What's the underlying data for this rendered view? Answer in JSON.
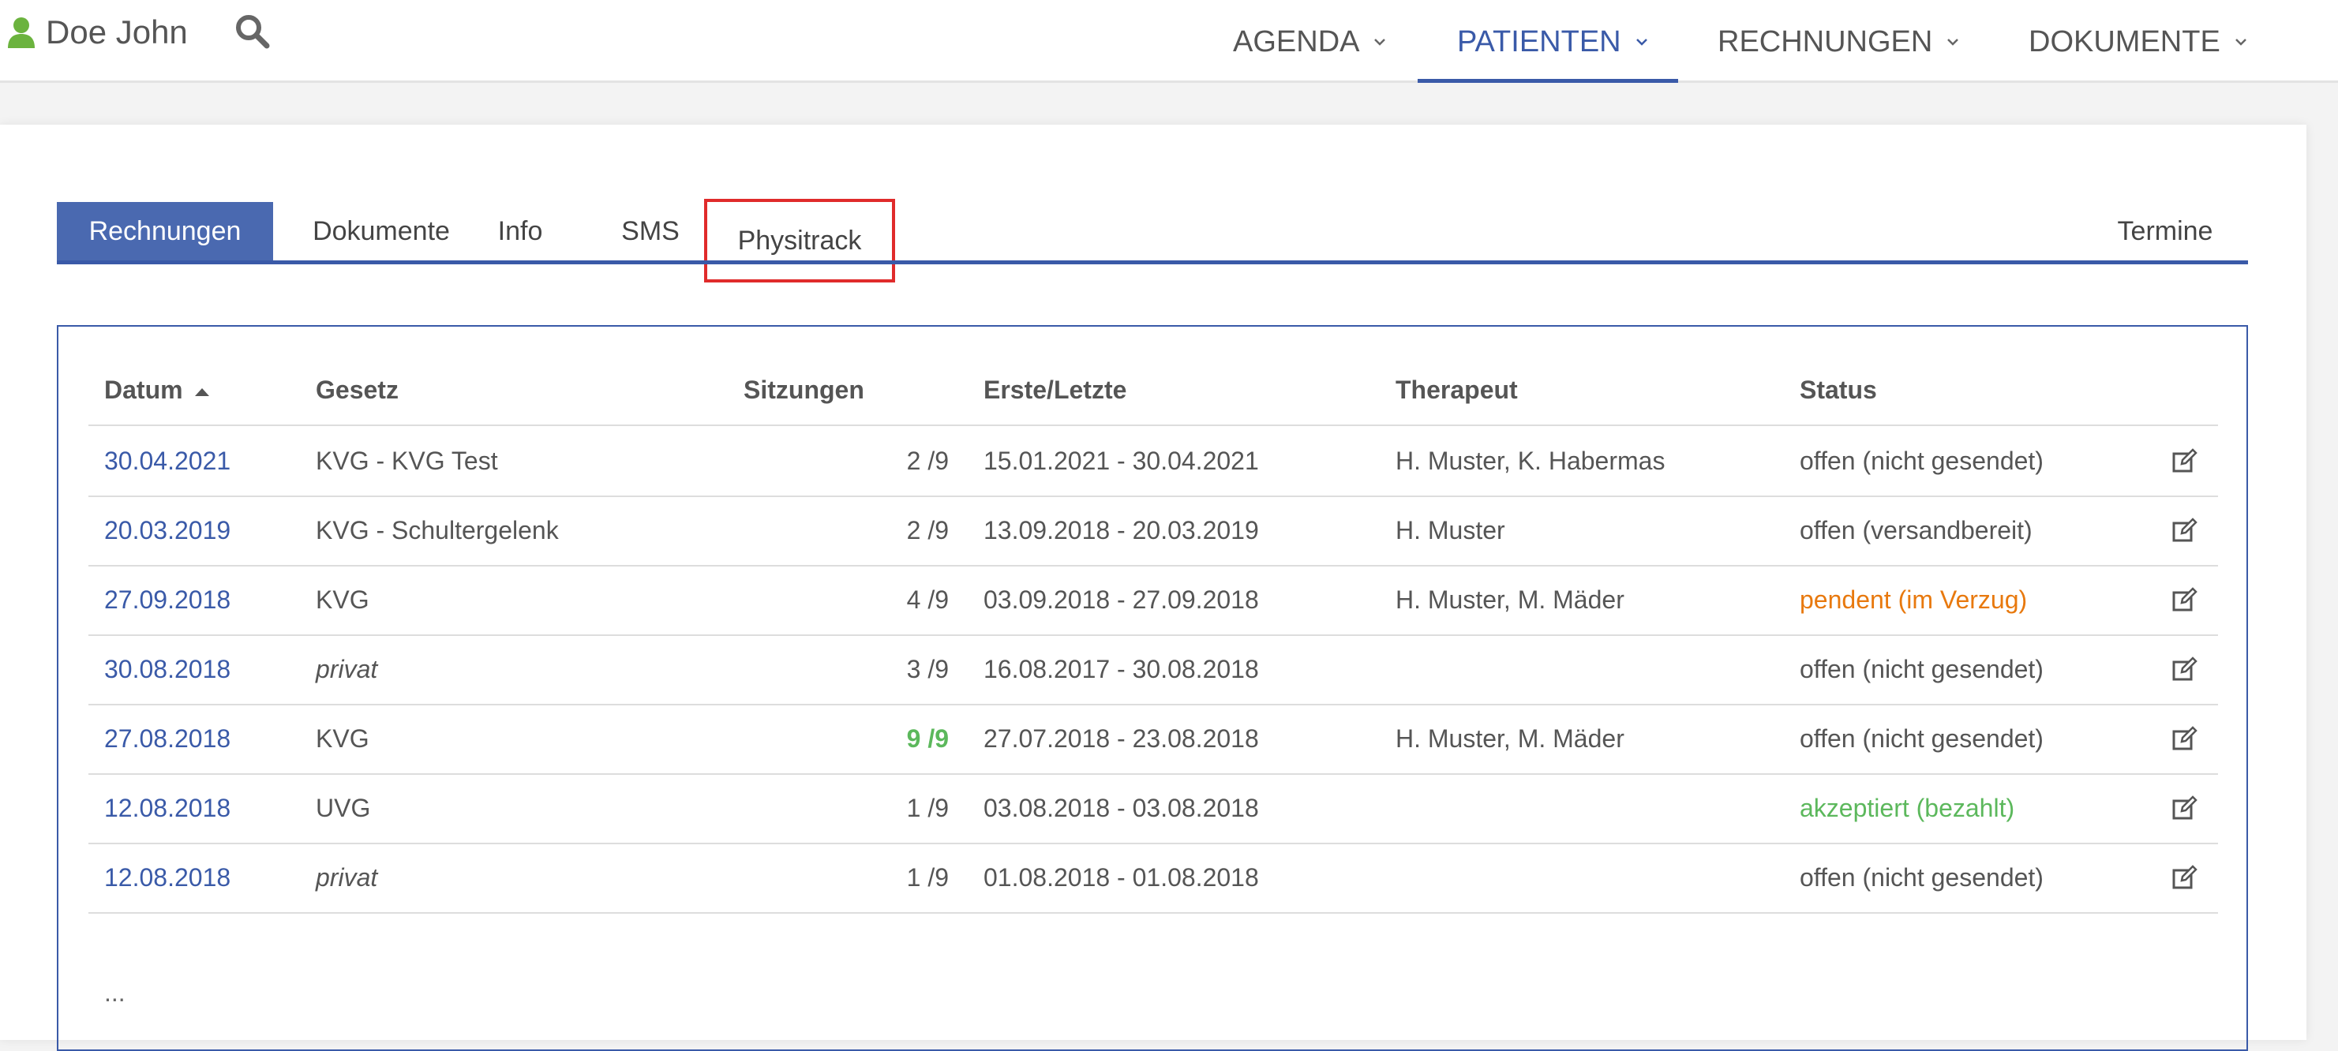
{
  "header": {
    "user_name": "Doe John",
    "user_icon": "user-icon",
    "search_icon": "search-icon",
    "nav": [
      {
        "label": "AGENDA",
        "active": false
      },
      {
        "label": "PATIENTEN",
        "active": true
      },
      {
        "label": "RECHNUNGEN",
        "active": false
      },
      {
        "label": "DOKUMENTE",
        "active": false
      }
    ]
  },
  "tabs": [
    {
      "label": "Rechnungen",
      "active": true
    },
    {
      "label": "Dokumente",
      "active": false
    },
    {
      "label": "Info",
      "active": false
    },
    {
      "label": "SMS",
      "active": false
    },
    {
      "label": "Physitrack",
      "active": false,
      "highlighted": true
    },
    {
      "label": "Termine",
      "active": false
    }
  ],
  "table": {
    "columns": [
      "Datum",
      "Gesetz",
      "Sitzungen",
      "Erste/Letzte",
      "Therapeut",
      "Status"
    ],
    "sort_column": "Datum",
    "sort_direction": "ascending",
    "rows": [
      {
        "datum": "30.04.2021",
        "gesetz": "KVG - KVG Test",
        "sitzungen": "2 /9",
        "erste_letzte": "15.01.2021 - 30.04.2021",
        "therapeut": "H. Muster, K. Habermas",
        "status": "offen (nicht gesendet)"
      },
      {
        "datum": "20.03.2019",
        "gesetz": "KVG - Schultergelenk",
        "sitzungen": "2 /9",
        "erste_letzte": "13.09.2018 - 20.03.2019",
        "therapeut": "H. Muster",
        "status": "offen (versandbereit)"
      },
      {
        "datum": "27.09.2018",
        "gesetz": "KVG",
        "sitzungen": "4 /9",
        "erste_letzte": "03.09.2018 - 27.09.2018",
        "therapeut": "H. Muster, M. Mäder",
        "status": "pendent (im Verzug)"
      },
      {
        "datum": "30.08.2018",
        "gesetz": "privat",
        "sitzungen": "3 /9",
        "erste_letzte": "16.08.2017 - 30.08.2018",
        "therapeut": "",
        "status": "offen (nicht gesendet)"
      },
      {
        "datum": "27.08.2018",
        "gesetz": "KVG",
        "sitzungen": "9 /9",
        "erste_letzte": "27.07.2018 - 23.08.2018",
        "therapeut": "H. Muster, M. Mäder",
        "status": "offen (nicht gesendet)"
      },
      {
        "datum": "12.08.2018",
        "gesetz": "UVG",
        "sitzungen": "1 /9",
        "erste_letzte": "03.08.2018 - 03.08.2018",
        "therapeut": "",
        "status": "akzeptiert (bezahlt)"
      },
      {
        "datum": "12.08.2018",
        "gesetz": "privat",
        "sitzungen": "1 /9",
        "erste_letzte": "01.08.2018 - 01.08.2018",
        "therapeut": "",
        "status": "offen (nicht gesendet)"
      }
    ],
    "more_indicator": "...",
    "edit_icon": "edit-icon"
  },
  "colors": {
    "accent": "#3a5aa8",
    "tab_active_bg": "#4a69b0",
    "highlight_box": "#e02b2b",
    "status_warning": "#e8790e",
    "status_success": "#5cb85c",
    "user_icon": "#6bb33e"
  }
}
